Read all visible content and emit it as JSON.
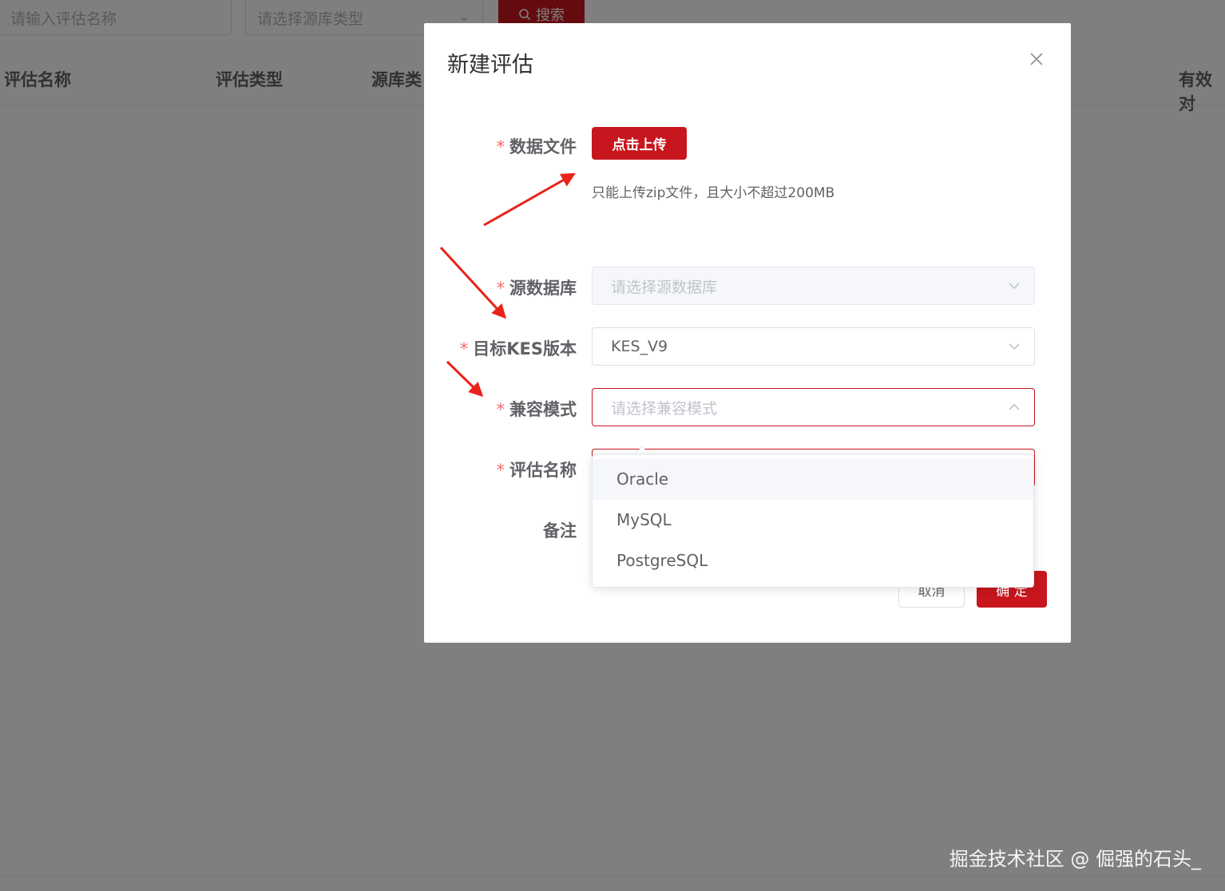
{
  "background": {
    "filter_name_placeholder": "请输入评估名称",
    "filter_type_placeholder": "请选择源库类型",
    "search_label": "搜索",
    "columns": [
      "评估名称",
      "评估类型",
      "源库类",
      "有效对"
    ]
  },
  "dialog": {
    "title": "新建评估",
    "fields": {
      "data_file": {
        "label": "数据文件",
        "button": "点击上传",
        "tip": "只能上传zip文件，且大小不超过200MB"
      },
      "source_db": {
        "label": "源数据库",
        "placeholder": "请选择源数据库"
      },
      "target_kes": {
        "label": "目标KES版本",
        "value": "KES_V9"
      },
      "compat_mode": {
        "label": "兼容模式",
        "placeholder": "请选择兼容模式"
      },
      "eval_name": {
        "label": "评估名称"
      },
      "remark": {
        "label": "备注"
      }
    },
    "cancel_label": "取消",
    "ok_label": "确 定"
  },
  "dropdown": {
    "options": [
      "Oracle",
      "MySQL",
      "PostgreSQL"
    ],
    "hovered_index": 0
  },
  "watermark": "掘金技术社区 @ 倔强的石头_",
  "colors": {
    "primary": "#c8161e",
    "required": "#f56c6c",
    "annotation_arrow": "#e8231b"
  }
}
